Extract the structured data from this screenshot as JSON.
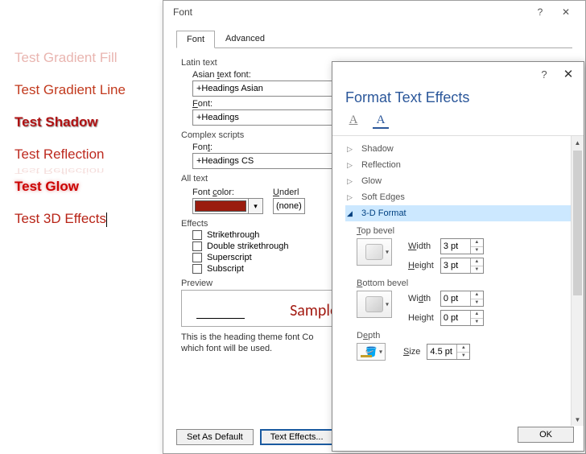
{
  "samples": {
    "gradfill": "Test Gradient Fill",
    "gradline": "Test Gradient Line",
    "shadow": "Test Shadow",
    "reflection": "Test Reflection",
    "glow": "Test Glow",
    "threed": "Test 3D Effects"
  },
  "font_dialog": {
    "title": "Font",
    "tabs": {
      "font": "Font",
      "advanced": "Advanced"
    },
    "latin_text": "Latin text",
    "asian_font_label": "Asian text font:",
    "asian_font_value": "+Headings Asian",
    "font_label": "Font:",
    "font_value": "+Headings",
    "complex_scripts": "Complex scripts",
    "cs_font_label": "Font:",
    "cs_font_value": "+Headings CS",
    "all_text": "All text",
    "font_color_label": "Font color:",
    "underline_label": "Underl",
    "underline_value": "(none)",
    "effects": "Effects",
    "strike": "Strikethrough",
    "dstrike": "Double strikethrough",
    "superscript": "Superscript",
    "subscript": "Subscript",
    "preview": "Preview",
    "sample": "Sample",
    "desc": "This is the heading theme font Co\nwhich font will be used.",
    "set_default": "Set As Default",
    "text_effects": "Text Effects..."
  },
  "fte": {
    "heading": "Format Text Effects",
    "items": {
      "shadow": "Shadow",
      "reflection": "Reflection",
      "glow": "Glow",
      "softedges": "Soft Edges",
      "format3d": "3-D Format"
    },
    "top_bevel": "Top bevel",
    "bottom_bevel": "Bottom bevel",
    "width": "Width",
    "height": "Height",
    "depth": "Depth",
    "size": "Size",
    "top_w": "3 pt",
    "top_h": "3 pt",
    "bot_w": "0 pt",
    "bot_h": "0 pt",
    "depth_size": "4.5 pt",
    "ok": "OK"
  }
}
